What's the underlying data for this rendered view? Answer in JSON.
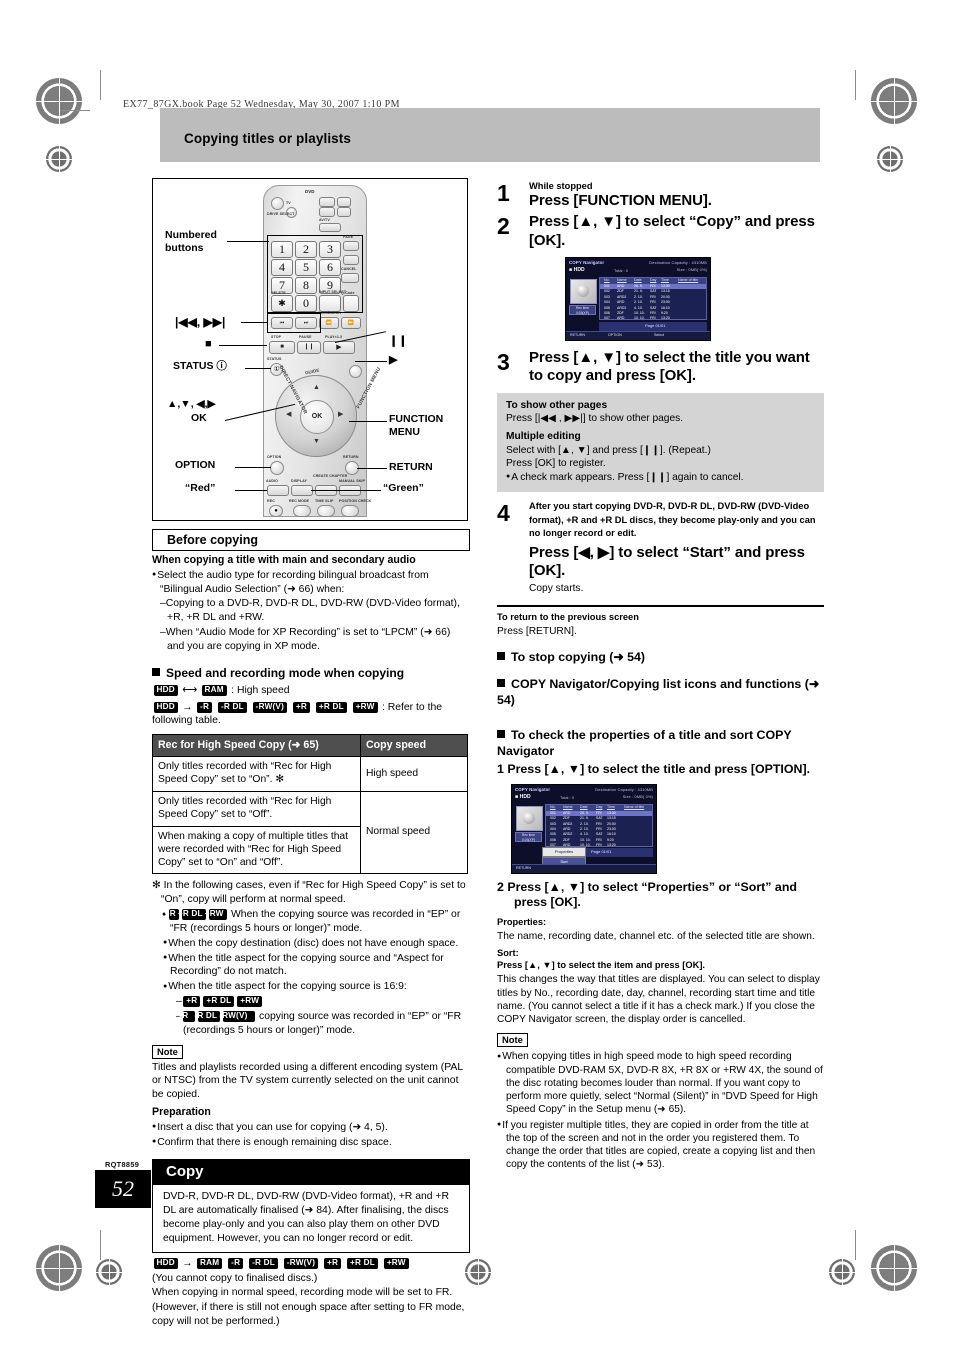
{
  "header": {
    "book_line": "EX77_87GX.book  Page 52  Wednesday, May 30, 2007  1:10 PM",
    "section_title": "Copying titles or playlists"
  },
  "footer": {
    "code": "RQT8859",
    "page_number": "52"
  },
  "remote": {
    "labels": {
      "numbered_buttons": "Numbered\nbuttons",
      "skip": "|◀◀ , ▶▶|",
      "stop": "■",
      "status": "STATUS ⓘ",
      "arrows": "▲,▼, ◀,▶",
      "ok": "OK",
      "option": "OPTION",
      "red": "“Red”",
      "pause": "❙❙",
      "play": "▶",
      "function_menu": "FUNCTION\nMENU",
      "return": "RETURN",
      "green": "“Green”"
    },
    "keys": {
      "numbers": [
        "1",
        "2",
        "3",
        "4",
        "5",
        "6",
        "7",
        "8",
        "9",
        "0"
      ],
      "delete": "DELETE",
      "delete_glyph": "✱",
      "input_select": "INPUT SELECT",
      "cancel": "CANCEL",
      "q_code": "Q-Code",
      "slow_search": "SLOW/SEARCH",
      "stop": "STOP",
      "pause": "PAUSE",
      "play": "PLAY×1.3",
      "status_small": "STATUS",
      "guide": "GUIDE",
      "exit": "EXIT",
      "direct_navigator": "DIRECT NAVIGATOR",
      "function_menu_curve": "FUNCTION MENU",
      "return_small": "RETURN",
      "option_small": "OPTION",
      "ok": "OK",
      "audio": "AUDIO",
      "display": "DISPLAY",
      "create_chapter": "CREATE CHAPTER",
      "manual_skip": "MANUAL SKIP",
      "rec": "REC",
      "rec_mode": "REC MODE",
      "time_slip": "TIME SLIP",
      "pos_check": "POSITION CHECK",
      "dvd": "DVD",
      "tv": "TV",
      "drive_select": "DRIVE SELECT",
      "page": "PAGE"
    }
  },
  "left": {
    "before_copying_heading": "Before copying",
    "main_sub_audio_heading": "When copying a title with main and secondary audio",
    "main_sub_audio_bullet": "Select the audio type for recording bilingual broadcast from “Bilingual Audio Selection” (➜ 66) when:",
    "main_sub_audio_dash1": "–Copying to a DVD-R, DVD-R DL, DVD-RW (DVD-Video format), +R, +R DL and +RW.",
    "main_sub_audio_dash2": "–When “Audio Mode for XP Recording” is set to “LPCM” (➜ 66) and you are copying in XP mode.",
    "speed_heading": "Speed and recording mode when copying",
    "speed_line1_prefix": "",
    "speed_line1_suffix": ": High speed",
    "speed_line2_suffix": ": Refer to the following table.",
    "speed_line1_tags": [
      "HDD",
      "RAM"
    ],
    "speed_line1_arrow": "⟷",
    "speed_line2_tag_left": "HDD",
    "speed_line2_arrow": "→",
    "speed_line2_tags": [
      "-R",
      "-R DL",
      "-RW(V)",
      "+R",
      "+R DL",
      "+RW"
    ],
    "table": {
      "headers": [
        "Rec for High Speed Copy (➜ 65)",
        "Copy speed"
      ],
      "rows": [
        {
          "desc": "Only titles recorded with “Rec for High Speed Copy” set to “On”. ✻",
          "speed": "High speed"
        },
        {
          "desc": "Only titles recorded with “Rec for High Speed Copy” set to “Off”.",
          "speed": ""
        },
        {
          "desc": "When making a copy of multiple titles that were recorded with “Rec for High Speed Copy” set to “On” and “Off”.",
          "speed": "Normal speed"
        }
      ]
    },
    "footnote_intro": "✻ In the following cases, even if “Rec for High Speed Copy” is set to “On”, copy will perform at normal speed.",
    "footnote_b1_tags": [
      "+R",
      "+R DL",
      "+RW"
    ],
    "footnote_b1_text": "When the copying source was recorded in “EP” or “FR (recordings 5 hours or longer)” mode.",
    "footnote_b2": "When the copy destination (disc) does not have enough space.",
    "footnote_b3": "When the title aspect for the copying source and “Aspect for Recording” do not match.",
    "footnote_b4": "When the title aspect for the copying source is 16:9:",
    "footnote_b4_d1_tags": [
      "+R",
      "+R DL",
      "+RW"
    ],
    "footnote_b4_d2_tags": [
      "-R",
      "-R DL",
      "-RW(V)"
    ],
    "footnote_b4_d2_text": "copying source was recorded in “EP” or “FR (recordings 5 hours or longer)” mode.",
    "note_badge": "Note",
    "note_text": "Titles and playlists recorded using a different encoding system (PAL or NTSC) from the TV system currently selected on the unit cannot be copied.",
    "preparation_heading": "Preparation",
    "preparation_b1": "Insert a disc that you can use for copying (➜ 4, 5).",
    "preparation_b2": "Confirm that there is enough remaining disc space.",
    "copy_heading": "Copy",
    "copy_box_text": "DVD-R, DVD-R DL, DVD-RW (DVD-Video format), +R and +R DL are automatically finalised (➜ 84). After finalising, the discs become play-only and you can also play them on other DVD equipment. However, you can no longer record or edit.",
    "copy_tags_left": "HDD",
    "copy_tags_arrow": "→",
    "copy_tags": [
      "RAM",
      "-R",
      "-R DL",
      "-RW(V)",
      "+R",
      "+R DL",
      "+RW"
    ],
    "copy_note1": "(You cannot copy to finalised discs.)",
    "copy_note2": "When copying in normal speed, recording mode will be set to FR.",
    "copy_note3": "(However, if there is still not enough space after setting to FR mode, copy will not be performed.)"
  },
  "right": {
    "step1": {
      "num": "1",
      "lead": "While stopped",
      "text": "Press [FUNCTION MENU]."
    },
    "step2": {
      "num": "2",
      "text": "Press [▲, ▼] to select “Copy” and press [OK]."
    },
    "step3": {
      "num": "3",
      "text": "Press [▲, ▼] to select the title you want to copy and press [OK].",
      "box": {
        "h1": "To show other pages",
        "t1": "Press [|◀◀ , ▶▶|] to show other pages.",
        "h2": "Multiple editing",
        "t2": "Select with [▲, ▼] and press [❙❙]. (Repeat.)",
        "t3": "Press [OK] to register.",
        "t4": "A check mark appears. Press [❙❙] again to cancel."
      }
    },
    "step4": {
      "num": "4",
      "lead": "After you start copying DVD-R, DVD-R DL, DVD-RW (DVD-Video format), +R and +R DL discs, they become play-only and you can no longer record or edit.",
      "text": "Press [◀, ▶] to select “Start” and press [OK].",
      "after": "Copy starts."
    },
    "return_heading": "To return to the previous screen",
    "return_text": "Press [RETURN].",
    "sect_stop": "To stop copying (➜ 54)",
    "sect_icons": "COPY Navigator/Copying list icons and functions (➜ 54)",
    "sect_props": "To check the properties of a title and sort COPY Navigator",
    "props_step1": "1  Press [▲, ▼] to select the title and press [OPTION].",
    "props_step2": "2  Press [▲, ▼] to select “Properties” or “Sort” and press [OK].",
    "properties_label": "Properties:",
    "properties_text": "The name, recording date, channel etc. of the selected title are shown.",
    "sort_label": "Sort:",
    "sort_bold": "Press [▲, ▼] to select the item and press [OK].",
    "sort_text": "This changes the way that titles are displayed. You can select to display titles by No., recording date, day, channel, recording start time and title name. (You cannot select a title if it has a check mark.) If you close the COPY Navigator screen, the display order is cancelled.",
    "note_badge": "Note",
    "note_b1": "When copying titles in high speed mode to high speed recording compatible DVD-RAM 5X, DVD-R 8X, +R 8X or +RW 4X, the sound of the disc rotating becomes louder than normal. If you want copy to perform more quietly, select “Normal (Silent)” in “DVD Speed for High Speed Copy” in the Setup menu (➜ 65).",
    "note_b2": "If you register multiple titles, they are copied in order from the title at the top of the screen and not in the order you registered them. To change the order that titles are copied, create a copying list and then copy the contents of the list (➜ 53)."
  },
  "tv_screen": {
    "title": "COPY Navigator",
    "drive": "HDD",
    "total": "Total : 0",
    "dest_capacity": "Destination Capacity : 4310MB",
    "size": "Size : 0MB( 0%)",
    "columns": [
      "No.",
      "Name",
      "Date",
      "Day",
      "Time",
      "Name of title"
    ],
    "rows": [
      {
        "no": "001",
        "name": "ARD",
        "date": "26. 9.",
        "day": "FRI",
        "time": "13:30"
      },
      {
        "no": "002",
        "name": "ZDF",
        "date": "21. 9.",
        "day": "SAT",
        "time": "13:15"
      },
      {
        "no": "003",
        "name": "ARD2",
        "date": "2. 10.",
        "day": "FRI",
        "time": "20:00"
      },
      {
        "no": "004",
        "name": "ARD",
        "date": "2. 10.",
        "day": "FRI",
        "time": "23:00"
      },
      {
        "no": "005",
        "name": "ARD2",
        "date": "4. 10.",
        "day": "SAT",
        "time": "16:10"
      },
      {
        "no": "006",
        "name": "ZDF",
        "date": "10. 10.",
        "day": "FRI",
        "time": "9:20"
      },
      {
        "no": "007",
        "name": "ARD",
        "date": "10. 10.",
        "day": "FRI",
        "time": "13:20"
      },
      {
        "no": "008",
        "name": "ARD",
        "date": "11. 10.",
        "day": "SAT",
        "time": "21:00"
      }
    ],
    "page_label": "Page 01/01",
    "rec_time": "Rec time\n0:03(XP)",
    "btn_return": "RETURN",
    "btn_option": "OPTION",
    "btn_select": "Select",
    "menu_properties": "Properties",
    "menu_sort": "Sort"
  },
  "colors": {
    "header_band": "#bcbcbc",
    "table_header": "#4e4e4e",
    "grey_box": "#d4d4d4",
    "tag_bg": "#000000"
  }
}
